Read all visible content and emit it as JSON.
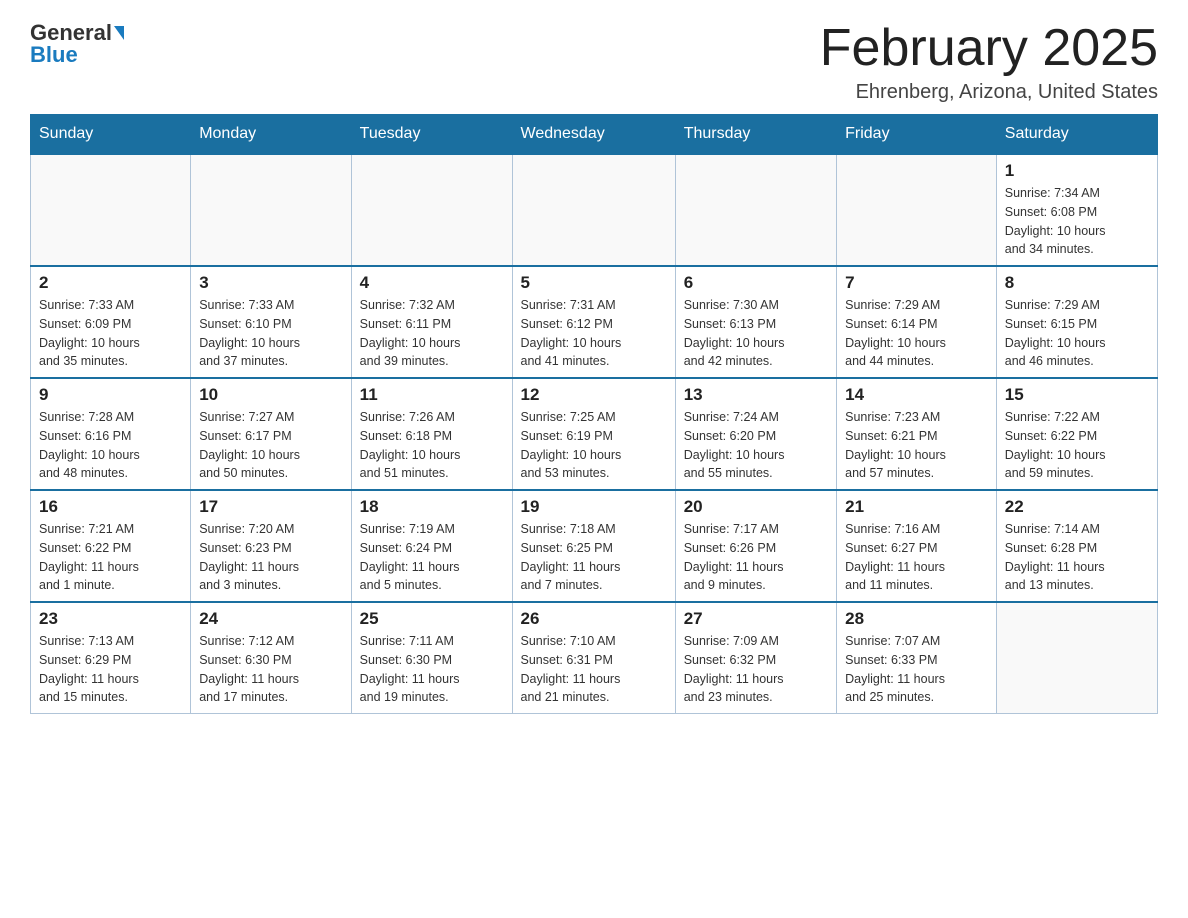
{
  "logo": {
    "text_black": "General",
    "text_blue": "Blue"
  },
  "title": "February 2025",
  "location": "Ehrenberg, Arizona, United States",
  "days_of_week": [
    "Sunday",
    "Monday",
    "Tuesday",
    "Wednesday",
    "Thursday",
    "Friday",
    "Saturday"
  ],
  "weeks": [
    [
      {
        "day": "",
        "info": ""
      },
      {
        "day": "",
        "info": ""
      },
      {
        "day": "",
        "info": ""
      },
      {
        "day": "",
        "info": ""
      },
      {
        "day": "",
        "info": ""
      },
      {
        "day": "",
        "info": ""
      },
      {
        "day": "1",
        "info": "Sunrise: 7:34 AM\nSunset: 6:08 PM\nDaylight: 10 hours\nand 34 minutes."
      }
    ],
    [
      {
        "day": "2",
        "info": "Sunrise: 7:33 AM\nSunset: 6:09 PM\nDaylight: 10 hours\nand 35 minutes."
      },
      {
        "day": "3",
        "info": "Sunrise: 7:33 AM\nSunset: 6:10 PM\nDaylight: 10 hours\nand 37 minutes."
      },
      {
        "day": "4",
        "info": "Sunrise: 7:32 AM\nSunset: 6:11 PM\nDaylight: 10 hours\nand 39 minutes."
      },
      {
        "day": "5",
        "info": "Sunrise: 7:31 AM\nSunset: 6:12 PM\nDaylight: 10 hours\nand 41 minutes."
      },
      {
        "day": "6",
        "info": "Sunrise: 7:30 AM\nSunset: 6:13 PM\nDaylight: 10 hours\nand 42 minutes."
      },
      {
        "day": "7",
        "info": "Sunrise: 7:29 AM\nSunset: 6:14 PM\nDaylight: 10 hours\nand 44 minutes."
      },
      {
        "day": "8",
        "info": "Sunrise: 7:29 AM\nSunset: 6:15 PM\nDaylight: 10 hours\nand 46 minutes."
      }
    ],
    [
      {
        "day": "9",
        "info": "Sunrise: 7:28 AM\nSunset: 6:16 PM\nDaylight: 10 hours\nand 48 minutes."
      },
      {
        "day": "10",
        "info": "Sunrise: 7:27 AM\nSunset: 6:17 PM\nDaylight: 10 hours\nand 50 minutes."
      },
      {
        "day": "11",
        "info": "Sunrise: 7:26 AM\nSunset: 6:18 PM\nDaylight: 10 hours\nand 51 minutes."
      },
      {
        "day": "12",
        "info": "Sunrise: 7:25 AM\nSunset: 6:19 PM\nDaylight: 10 hours\nand 53 minutes."
      },
      {
        "day": "13",
        "info": "Sunrise: 7:24 AM\nSunset: 6:20 PM\nDaylight: 10 hours\nand 55 minutes."
      },
      {
        "day": "14",
        "info": "Sunrise: 7:23 AM\nSunset: 6:21 PM\nDaylight: 10 hours\nand 57 minutes."
      },
      {
        "day": "15",
        "info": "Sunrise: 7:22 AM\nSunset: 6:22 PM\nDaylight: 10 hours\nand 59 minutes."
      }
    ],
    [
      {
        "day": "16",
        "info": "Sunrise: 7:21 AM\nSunset: 6:22 PM\nDaylight: 11 hours\nand 1 minute."
      },
      {
        "day": "17",
        "info": "Sunrise: 7:20 AM\nSunset: 6:23 PM\nDaylight: 11 hours\nand 3 minutes."
      },
      {
        "day": "18",
        "info": "Sunrise: 7:19 AM\nSunset: 6:24 PM\nDaylight: 11 hours\nand 5 minutes."
      },
      {
        "day": "19",
        "info": "Sunrise: 7:18 AM\nSunset: 6:25 PM\nDaylight: 11 hours\nand 7 minutes."
      },
      {
        "day": "20",
        "info": "Sunrise: 7:17 AM\nSunset: 6:26 PM\nDaylight: 11 hours\nand 9 minutes."
      },
      {
        "day": "21",
        "info": "Sunrise: 7:16 AM\nSunset: 6:27 PM\nDaylight: 11 hours\nand 11 minutes."
      },
      {
        "day": "22",
        "info": "Sunrise: 7:14 AM\nSunset: 6:28 PM\nDaylight: 11 hours\nand 13 minutes."
      }
    ],
    [
      {
        "day": "23",
        "info": "Sunrise: 7:13 AM\nSunset: 6:29 PM\nDaylight: 11 hours\nand 15 minutes."
      },
      {
        "day": "24",
        "info": "Sunrise: 7:12 AM\nSunset: 6:30 PM\nDaylight: 11 hours\nand 17 minutes."
      },
      {
        "day": "25",
        "info": "Sunrise: 7:11 AM\nSunset: 6:30 PM\nDaylight: 11 hours\nand 19 minutes."
      },
      {
        "day": "26",
        "info": "Sunrise: 7:10 AM\nSunset: 6:31 PM\nDaylight: 11 hours\nand 21 minutes."
      },
      {
        "day": "27",
        "info": "Sunrise: 7:09 AM\nSunset: 6:32 PM\nDaylight: 11 hours\nand 23 minutes."
      },
      {
        "day": "28",
        "info": "Sunrise: 7:07 AM\nSunset: 6:33 PM\nDaylight: 11 hours\nand 25 minutes."
      },
      {
        "day": "",
        "info": ""
      }
    ]
  ]
}
